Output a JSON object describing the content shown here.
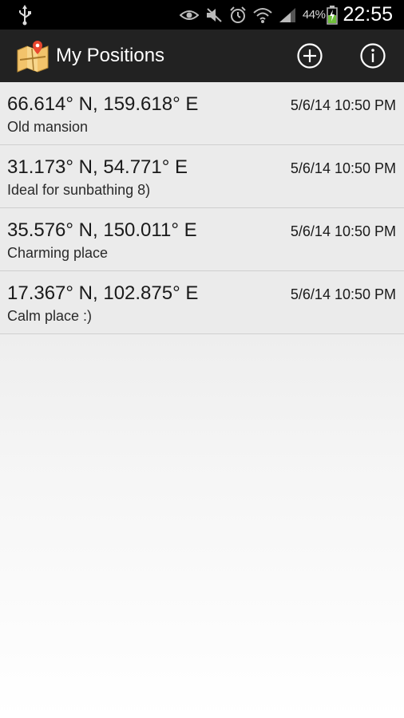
{
  "status_bar": {
    "icons": [
      "usb-icon",
      "eye-icon",
      "mute-icon",
      "alarm-icon",
      "wifi-icon",
      "signal-icon",
      "battery-icon"
    ],
    "battery_percent": "44%",
    "time": "22:55"
  },
  "action_bar": {
    "title": "My Positions",
    "icons": [
      "app-map-icon",
      "add-icon",
      "info-icon"
    ]
  },
  "positions": [
    {
      "coords": "66.614° N, 159.618° E",
      "date": "5/6/14 10:50 PM",
      "description": "Old mansion"
    },
    {
      "coords": "31.173° N, 54.771° E",
      "date": "5/6/14 10:50 PM",
      "description": "Ideal for sunbathing 8)"
    },
    {
      "coords": "35.576° N, 150.011° E",
      "date": "5/6/14 10:50 PM",
      "description": "Charming place"
    },
    {
      "coords": "17.367° N, 102.875° E",
      "date": "5/6/14 10:50 PM",
      "description": "Calm place :)"
    }
  ],
  "colors": {
    "status_bar_bg": "#000000",
    "action_bar_bg": "#222222",
    "list_row_bg": "#ebebeb",
    "battery_accent": "#6fbf3a",
    "map_pin": "#e8472f"
  }
}
